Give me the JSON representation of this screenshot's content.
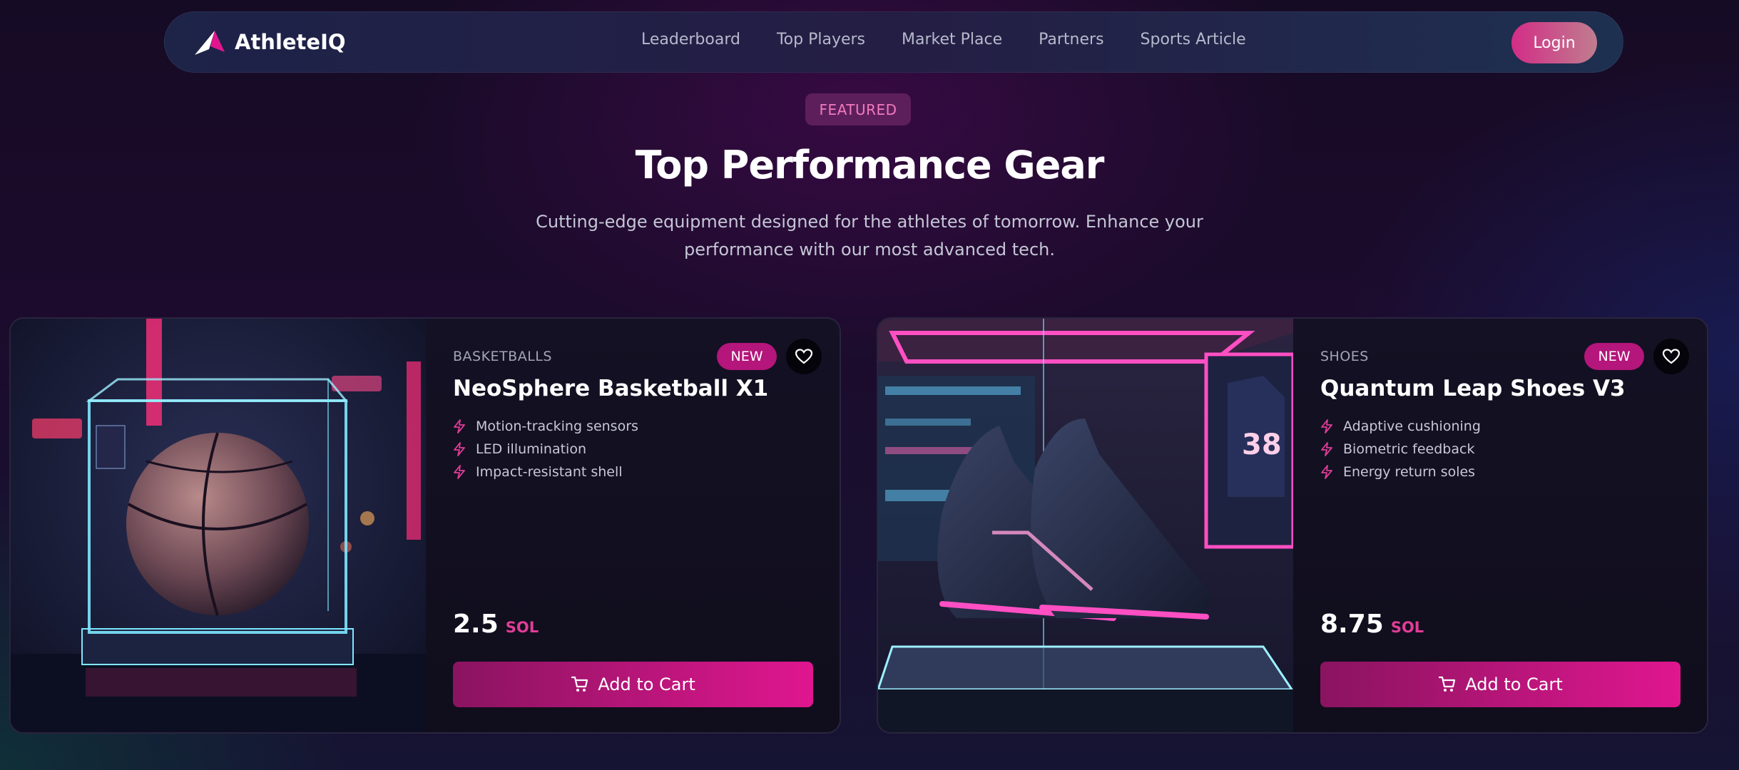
{
  "brand": {
    "name": "AthleteIQ",
    "icon": "athleteiq-logo-icon"
  },
  "nav": {
    "links": [
      "Leaderboard",
      "Top Players",
      "Market Place",
      "Partners",
      "Sports Article"
    ],
    "login_label": "Login"
  },
  "hero": {
    "badge": "FEATURED",
    "title": "Top Performance Gear",
    "subtitle_line1": "Cutting-edge equipment designed for the athletes of tomorrow. Enhance your",
    "subtitle_line2": "performance with our most advanced tech."
  },
  "products": [
    {
      "category": "BASKETBALLS",
      "tag": "NEW",
      "name": "NeoSphere Basketball X1",
      "features": [
        "Motion-tracking sensors",
        "LED illumination",
        "Impact-resistant shell"
      ],
      "price": "2.5",
      "currency": "SOL",
      "cart_label": "Add to Cart",
      "image_icon": "basketball-display-image"
    },
    {
      "category": "SHOES",
      "tag": "NEW",
      "name": "Quantum Leap Shoes V3",
      "features": [
        "Adaptive cushioning",
        "Biometric feedback",
        "Energy return soles"
      ],
      "price": "8.75",
      "currency": "SOL",
      "cart_label": "Add to Cart",
      "image_icon": "shoes-display-image"
    }
  ],
  "colors": {
    "accent": "#e0168f",
    "badge_bg": "#5d1f5b",
    "badge_text": "#f07bbd",
    "tag_bg": "#b4167b"
  }
}
